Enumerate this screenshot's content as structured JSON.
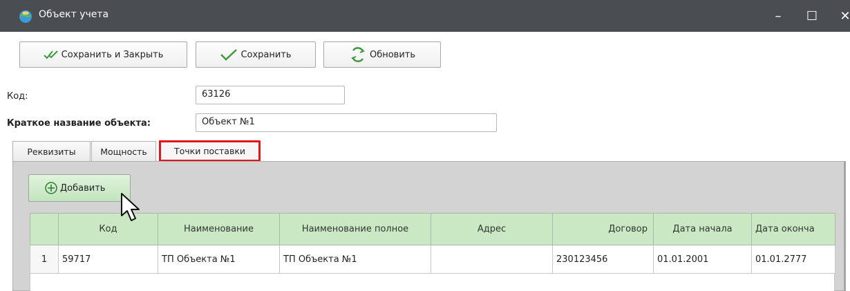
{
  "window": {
    "title": "Объект учета",
    "minimize_glyph": "–",
    "maximize_glyph": "☐",
    "close_glyph": "✕"
  },
  "toolbar": {
    "save_close_label": "Сохранить и Закрыть",
    "save_label": "Сохранить",
    "refresh_label": "Обновить"
  },
  "form": {
    "code_label": "Код:",
    "code_value": "63126",
    "short_name_label": "Краткое название объекта:",
    "short_name_value": "Объект №1"
  },
  "tabs": [
    {
      "label": "Реквизиты"
    },
    {
      "label": "Мощность"
    },
    {
      "label": "Точки поставки",
      "active": true
    }
  ],
  "panel": {
    "add_label": "Добавить"
  },
  "grid": {
    "columns": [
      "",
      "Код",
      "Наименование",
      "Наименование полное",
      "Адрес",
      "Договор",
      "Дата начала",
      "Дата оконча"
    ],
    "rows": [
      [
        "1",
        "59717",
        "ТП Объекта №1",
        "ТП Объекта №1",
        "",
        "230123456",
        "01.01.2001",
        "01.01.2777"
      ]
    ]
  },
  "colors": {
    "titlebar": "#4a4d52",
    "highlight_border": "#e3151b",
    "grid_header": "#c9e8c3",
    "add_button": "#c3e4be"
  }
}
